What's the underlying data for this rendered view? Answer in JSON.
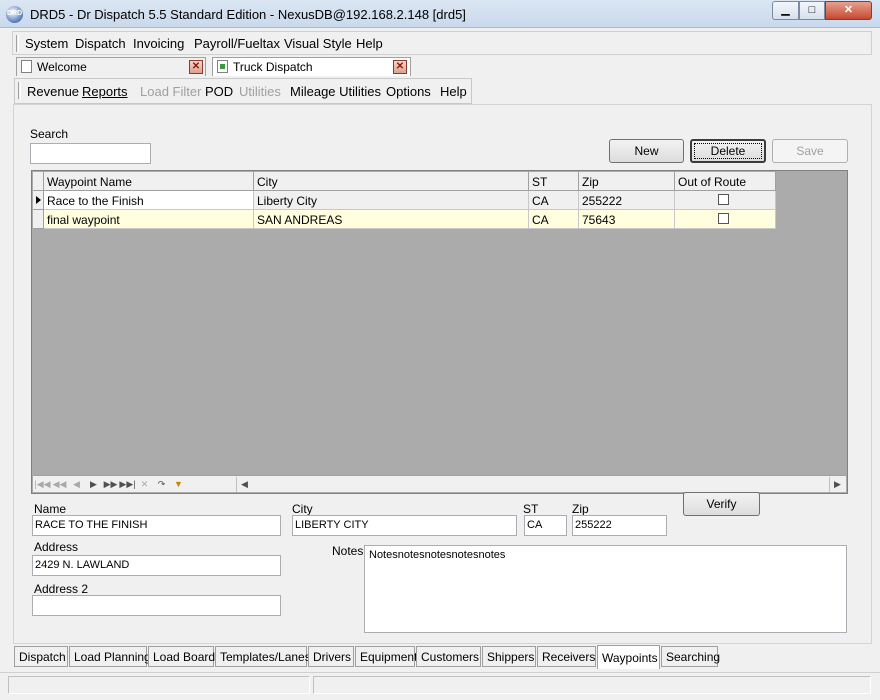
{
  "window": {
    "title": "DRD5 - Dr Dispatch 5.5 Standard Edition - NexusDB@192.168.2.148 [drd5]",
    "icon_text": "DRD"
  },
  "menu": [
    "System",
    "Dispatch",
    "Invoicing",
    "Payroll/Fueltax",
    "Visual Style",
    "Help"
  ],
  "doc_tabs": [
    {
      "label": "Welcome"
    },
    {
      "label": "Truck Dispatch"
    }
  ],
  "toolbar": [
    {
      "label": "Revenue",
      "enabled": true
    },
    {
      "label": "Reports",
      "enabled": true
    },
    {
      "label": "Load Filter",
      "enabled": false
    },
    {
      "label": "POD",
      "enabled": true
    },
    {
      "label": "Utilities",
      "enabled": false
    },
    {
      "label": "Mileage Utilities",
      "enabled": true
    },
    {
      "label": "Options",
      "enabled": true
    },
    {
      "label": "Help",
      "enabled": true
    }
  ],
  "search": {
    "label": "Search",
    "value": ""
  },
  "buttons": {
    "new": "New",
    "delete": "Delete",
    "save": "Save",
    "verify": "Verify"
  },
  "grid": {
    "columns": [
      "Waypoint Name",
      "City",
      "ST",
      "Zip",
      "Out of Route"
    ],
    "rows": [
      {
        "name": "Race to the Finish",
        "city": "Liberty City",
        "st": "CA",
        "zip": "255222",
        "out_of_route": false
      },
      {
        "name": "final waypoint",
        "city": "SAN ANDREAS",
        "st": "CA",
        "zip": "75643",
        "out_of_route": false
      }
    ]
  },
  "detail": {
    "name_label": "Name",
    "name_value": "RACE TO THE FINISH",
    "city_label": "City",
    "city_value": "LIBERTY CITY",
    "st_label": "ST",
    "st_value": "CA",
    "zip_label": "Zip",
    "zip_value": "255222",
    "address_label": "Address",
    "address_value": "2429 N. LAWLAND",
    "address2_label": "Address 2",
    "address2_value": "",
    "notes_label": "Notes",
    "notes_value": "Notesnotesnotesnotesnotes"
  },
  "bottom_tabs": [
    "Dispatch",
    "Load Planning",
    "Load Board",
    "Templates/Lanes",
    "Drivers",
    "Equipment",
    "Customers",
    "Shippers",
    "Receivers",
    "Waypoints",
    "Searching"
  ],
  "active_bottom_tab": "Waypoints"
}
